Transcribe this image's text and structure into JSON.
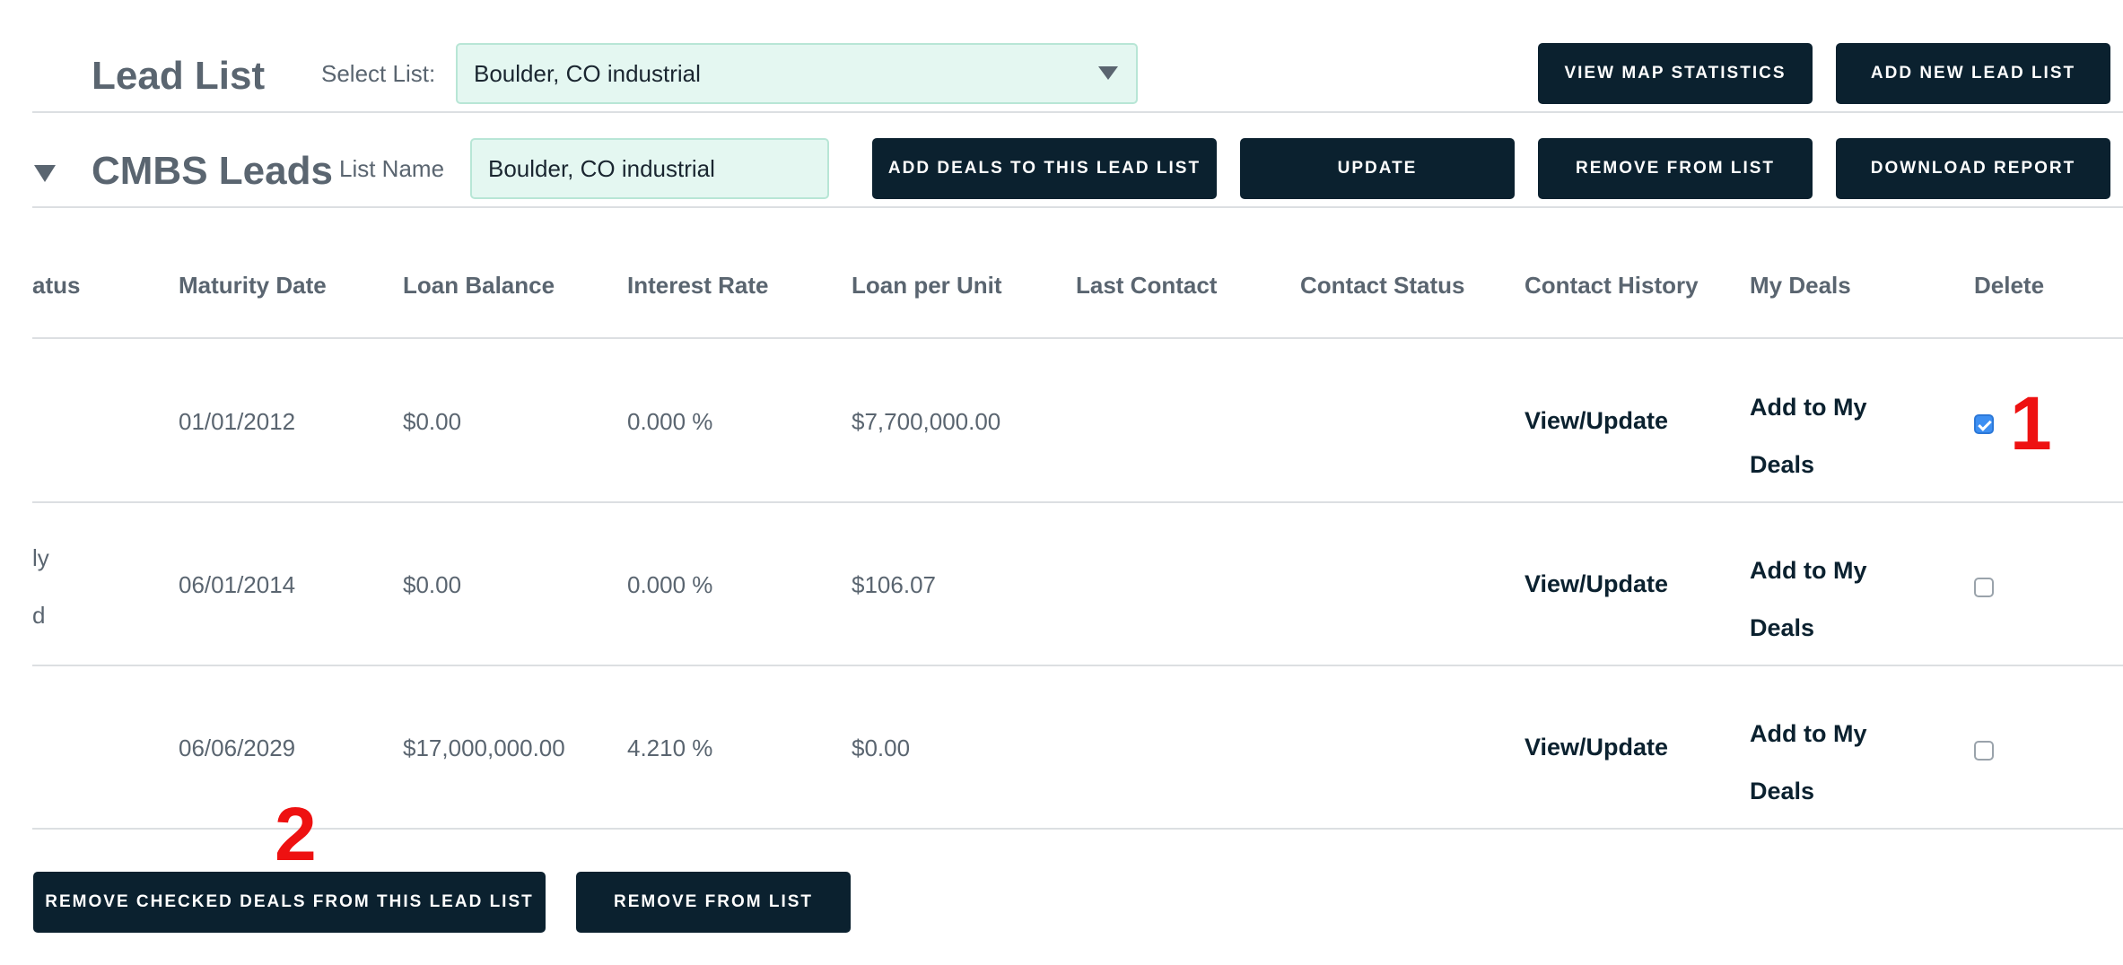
{
  "header": {
    "title": "Lead List",
    "select_label": "Select List:",
    "select_value": "Boulder, CO industrial",
    "view_map_button": "VIEW MAP STATISTICS",
    "add_new_button": "ADD NEW LEAD LIST"
  },
  "section": {
    "title": "CMBS Leads",
    "list_name_label": "List Name",
    "list_name_value": "Boulder, CO industrial",
    "add_deals_button": "ADD DEALS TO THIS LEAD LIST",
    "update_button": "UPDATE",
    "remove_button": "REMOVE FROM LIST",
    "download_button": "DOWNLOAD REPORT"
  },
  "table": {
    "columns": [
      "atus",
      "Maturity Date",
      "Loan Balance",
      "Interest Rate",
      "Loan per Unit",
      "Last Contact",
      "Contact Status",
      "Contact History",
      "My Deals",
      "Delete"
    ],
    "rows": [
      {
        "status": [
          "",
          ""
        ],
        "maturity": "01/01/2012",
        "balance": "$0.00",
        "rate": "0.000 %",
        "per_unit": "$7,700,000.00",
        "last_contact": "",
        "contact_status": "",
        "history": "View/Update",
        "my_deals": [
          "Add to My",
          "Deals"
        ],
        "delete_checked": true
      },
      {
        "status": [
          "ly",
          "d"
        ],
        "maturity": "06/01/2014",
        "balance": "$0.00",
        "rate": "0.000 %",
        "per_unit": "$106.07",
        "last_contact": "",
        "contact_status": "",
        "history": "View/Update",
        "my_deals": [
          "Add to My",
          "Deals"
        ],
        "delete_checked": false
      },
      {
        "status": [
          "",
          ""
        ],
        "maturity": "06/06/2029",
        "balance": "$17,000,000.00",
        "rate": "4.210 %",
        "per_unit": "$0.00",
        "last_contact": "",
        "contact_status": "",
        "history": "View/Update",
        "my_deals": [
          "Add to My",
          "Deals"
        ],
        "delete_checked": false
      }
    ]
  },
  "footer": {
    "remove_checked_button": "REMOVE CHECKED DEALS FROM THIS LEAD LIST",
    "remove_button": "REMOVE FROM LIST"
  },
  "annotations": [
    "1",
    "2"
  ],
  "colors": {
    "button_bg": "#0b212f",
    "field_bg": "#e4f7f1",
    "checkbox_checked": "#3d8ff2",
    "annotation": "#ee1111"
  },
  "icons": {
    "select_arrow": "caret-down-icon",
    "collapse_toggle": "triangle-down-icon"
  }
}
